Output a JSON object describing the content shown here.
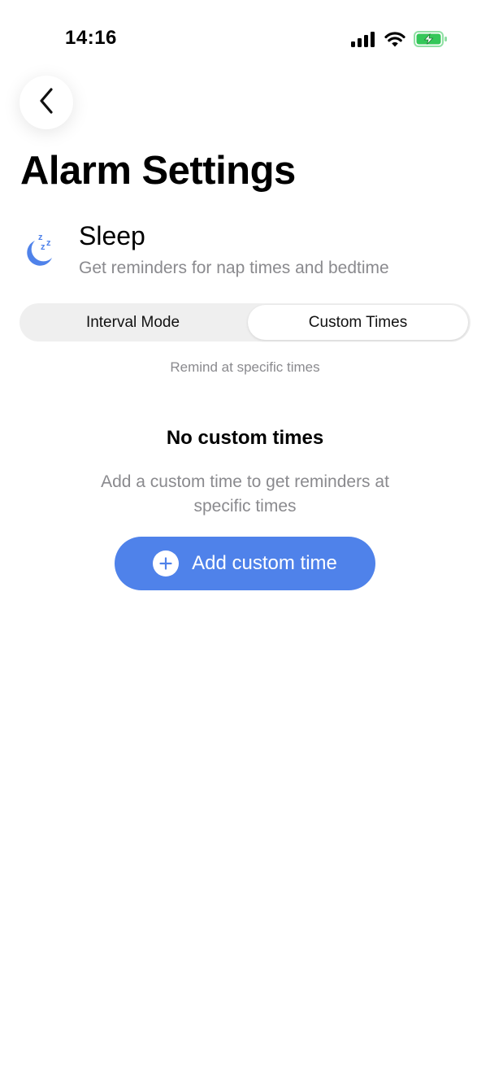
{
  "status_bar": {
    "time": "14:16",
    "icons": [
      "cellular-signal-icon",
      "wifi-icon",
      "battery-charging-icon"
    ],
    "battery_color": "#34c759"
  },
  "header": {
    "back_icon": "chevron-left-icon",
    "title": "Alarm Settings"
  },
  "category": {
    "icon": "sleep-moon-icon",
    "icon_color": "#4f82ea",
    "name": "Sleep",
    "description": "Get reminders for nap times and bedtime"
  },
  "mode_selector": {
    "options": [
      "Interval Mode",
      "Custom Times"
    ],
    "selected": "Custom Times",
    "hint": "Remind at specific times"
  },
  "empty_state": {
    "title": "No custom times",
    "description": "Add a custom time to get reminders at specific times"
  },
  "add_button": {
    "icon": "plus-circle-icon",
    "label": "Add custom time",
    "color": "#4f82ea"
  }
}
